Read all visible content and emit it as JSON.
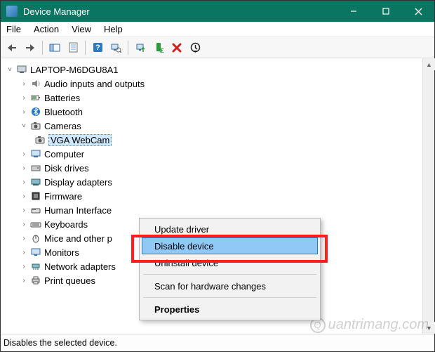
{
  "window": {
    "title": "Device Manager"
  },
  "menu": {
    "file": "File",
    "action": "Action",
    "view": "View",
    "help": "Help"
  },
  "tree": {
    "root": "LAPTOP-M6DGU8A1",
    "items": [
      "Audio inputs and outputs",
      "Batteries",
      "Bluetooth",
      "Cameras",
      "VGA WebCam",
      "Computer",
      "Disk drives",
      "Display adapters",
      "Firmware",
      "Human Interface",
      "Keyboards",
      "Mice and other p",
      "Monitors",
      "Network adapters",
      "Print queues"
    ]
  },
  "context_menu": {
    "update": "Update driver",
    "disable": "Disable device",
    "uninstall": "Uninstall device",
    "scan": "Scan for hardware changes",
    "properties": "Properties"
  },
  "status": "Disables the selected device.",
  "watermark": "uantrimang.com"
}
